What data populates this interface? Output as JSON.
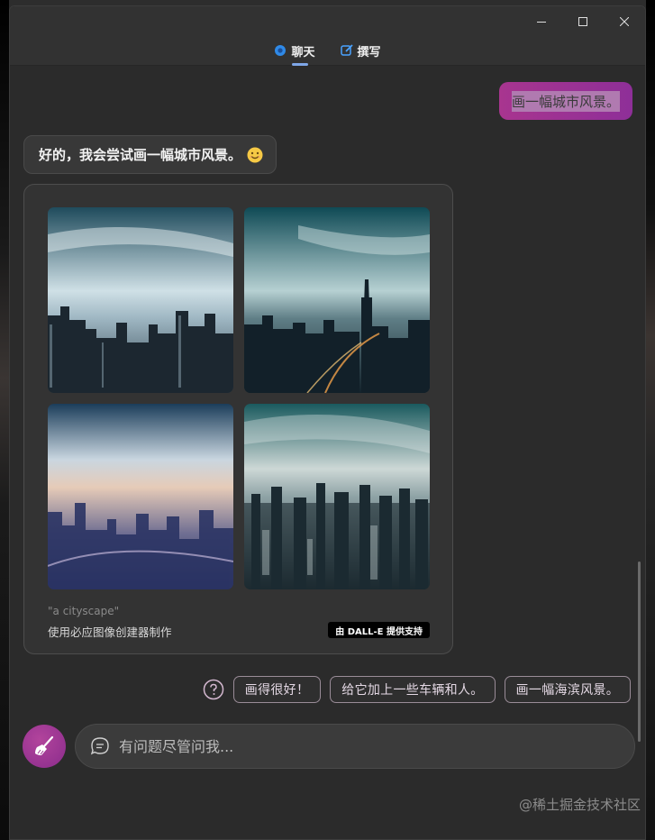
{
  "tabs": [
    {
      "label": "聊天",
      "icon": "chat-icon",
      "active": true
    },
    {
      "label": "撰写",
      "icon": "compose-icon",
      "active": false
    }
  ],
  "conversation": {
    "user_message": "画一幅城市风景。",
    "bot_message": "好的，我会尝试画一幅城市风景。",
    "bot_emoji": "smiling-face-icon"
  },
  "image_card": {
    "prompt": "\"a cityscape\"",
    "maker": "使用必应图像创建器制作",
    "badge": "由 DALL-E 提供支持",
    "images": [
      "cityscape-1",
      "cityscape-2",
      "cityscape-3",
      "cityscape-4"
    ]
  },
  "suggestions": [
    "画得很好！",
    "给它加上一些车辆和人。",
    "画一幅海滨风景。"
  ],
  "input": {
    "placeholder": "有问题尽管问我..."
  },
  "watermark": "@稀土掘金技术社区",
  "colors": {
    "accent": "#a8358f",
    "tab_indicator": "#7fa7e8",
    "background": "#2b2b2b"
  }
}
